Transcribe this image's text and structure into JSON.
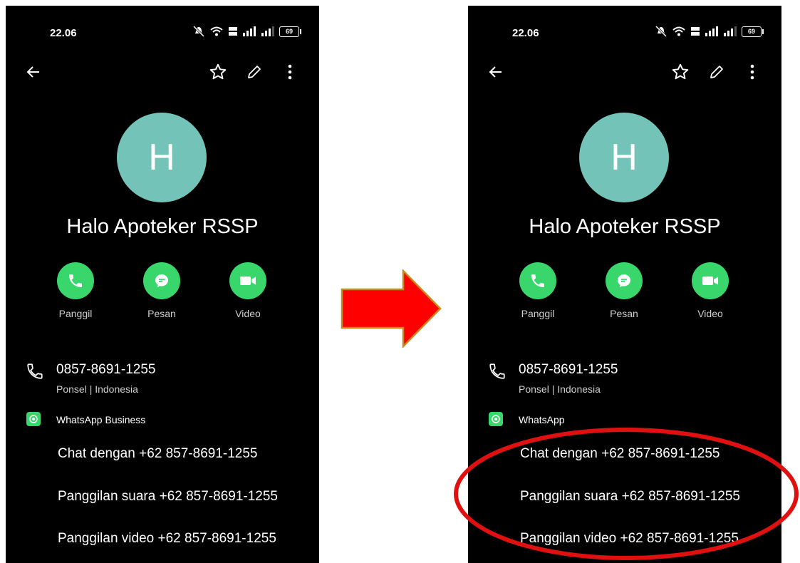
{
  "colors": {
    "background": "#000000",
    "avatar": "#74c3b9",
    "action_green": "#38d66b",
    "arrow_red": "#ff0000",
    "arrow_border": "#c68a1c",
    "ellipse_red": "#e01010"
  },
  "icons": {
    "topbar": [
      "back-arrow-icon",
      "star-icon",
      "edit-icon",
      "more-icon"
    ],
    "actions": [
      "phone-icon",
      "message-icon",
      "video-icon"
    ]
  },
  "screens": [
    {
      "status": {
        "time": "22.06",
        "battery": "69"
      },
      "avatar_letter": "H",
      "name": "Halo Apoteker RSSP",
      "actions": {
        "call": "Panggil",
        "message": "Pesan",
        "video": "Video"
      },
      "phone": {
        "number": "0857-8691-1255",
        "meta": "Ponsel  |  Indonesia"
      },
      "whatsapp": {
        "label": "WhatsApp Business",
        "chat": "Chat dengan +62 857-8691-1255",
        "voice": "Panggilan suara +62 857-8691-1255",
        "video": "Panggilan video +62 857-8691-1255"
      }
    },
    {
      "status": {
        "time": "22.06",
        "battery": "69"
      },
      "avatar_letter": "H",
      "name": "Halo Apoteker RSSP",
      "actions": {
        "call": "Panggil",
        "message": "Pesan",
        "video": "Video"
      },
      "phone": {
        "number": "0857-8691-1255",
        "meta": "Ponsel  |  Indonesia"
      },
      "whatsapp": {
        "label": "WhatsApp",
        "chat": "Chat dengan +62 857-8691-1255",
        "voice": "Panggilan suara +62 857-8691-1255",
        "video": "Panggilan video +62 857-8691-1255"
      }
    }
  ]
}
